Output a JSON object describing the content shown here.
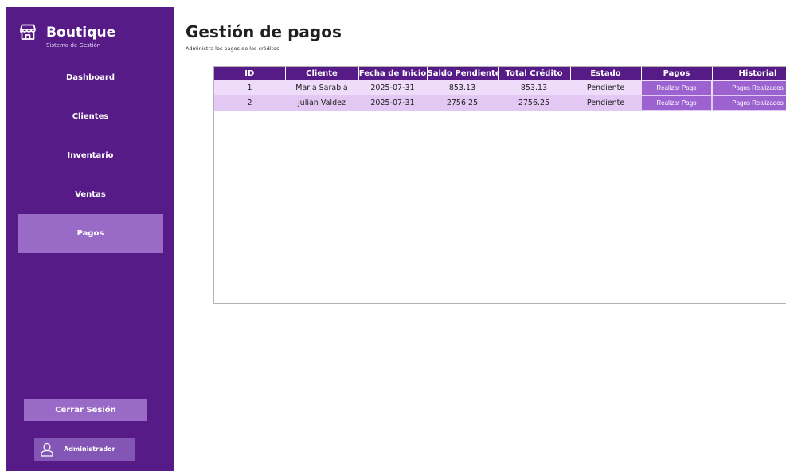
{
  "brand": {
    "title": "Boutique",
    "subtitle": "Sistema de Gestión"
  },
  "nav": [
    {
      "label": "Dashboard",
      "active": false
    },
    {
      "label": "Clientes",
      "active": false
    },
    {
      "label": "Inventario",
      "active": false
    },
    {
      "label": "Ventas",
      "active": false
    },
    {
      "label": "Pagos",
      "active": true
    }
  ],
  "logout_label": "Cerrar Sesión",
  "user": {
    "name": "Administrador"
  },
  "page": {
    "title": "Gestión de pagos",
    "subtitle": "Administra los pagos de los créditos"
  },
  "table": {
    "columns": [
      "ID",
      "Cliente",
      "Fecha de Inicio",
      "Saldo Pendiente",
      "Total Crédito",
      "Estado",
      "Pagos",
      "Historial"
    ],
    "rows": [
      {
        "id": "1",
        "cliente": "Maria Sarabia",
        "fecha": "2025-07-31",
        "saldo": "853.13",
        "total": "853.13",
        "estado": "Pendiente",
        "pago_btn": "Realizar Pago",
        "historial_btn": "Pagos Realizados"
      },
      {
        "id": "2",
        "cliente": "julian Valdez",
        "fecha": "2025-07-31",
        "saldo": "2756.25",
        "total": "2756.25",
        "estado": "Pendiente",
        "pago_btn": "Realizar Pago",
        "historial_btn": "Pagos Realizados"
      }
    ]
  },
  "colors": {
    "sidebar": "#561b87",
    "nav_active": "#9a6ac7",
    "header": "#561b87",
    "row_a": "#eedcfa",
    "row_b": "#e2c8f3",
    "button": "#9c62cf"
  },
  "icons": {
    "brand": "storefront-icon",
    "user": "user-icon"
  }
}
